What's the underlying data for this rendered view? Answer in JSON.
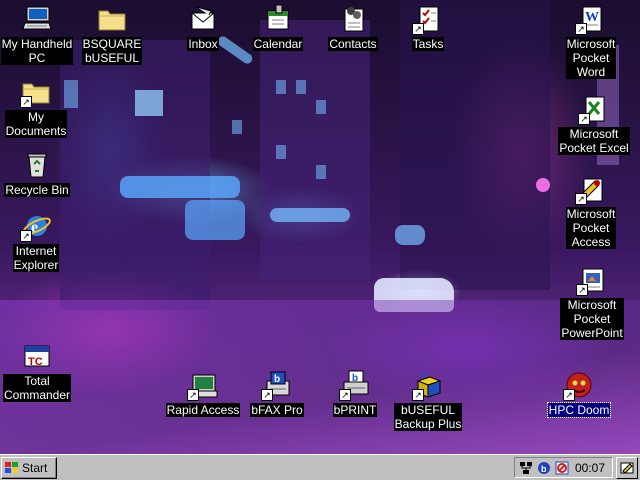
{
  "desktop": {
    "icons": [
      {
        "label": "My Handheld\nPC",
        "icon": "handheld-pc-icon",
        "shortcut": false
      },
      {
        "label": "BSQUARE\nbUSEFUL",
        "icon": "folder-icon",
        "shortcut": false
      },
      {
        "label": "Inbox",
        "icon": "inbox-icon",
        "shortcut": false
      },
      {
        "label": "Calendar",
        "icon": "calendar-icon",
        "shortcut": false
      },
      {
        "label": "Contacts",
        "icon": "contacts-icon",
        "shortcut": false
      },
      {
        "label": "Tasks",
        "icon": "tasks-icon",
        "shortcut": true
      },
      {
        "label": "Microsoft\nPocket\nWord",
        "icon": "pocket-word-icon",
        "shortcut": true
      },
      {
        "label": "My\nDocuments",
        "icon": "folder-icon",
        "shortcut": true
      },
      {
        "label": "Microsoft\nPocket Excel",
        "icon": "pocket-excel-icon",
        "shortcut": true
      },
      {
        "label": "Recycle Bin",
        "icon": "recycle-bin-icon",
        "shortcut": false
      },
      {
        "label": "Internet\nExplorer",
        "icon": "internet-explorer-icon",
        "shortcut": true
      },
      {
        "label": "Microsoft\nPocket\nAccess",
        "icon": "pocket-access-icon",
        "shortcut": true
      },
      {
        "label": "Microsoft\nPocket\nPowerPoint",
        "icon": "pocket-powerpoint-icon",
        "shortcut": true
      },
      {
        "label": "Total\nCommander",
        "icon": "total-commander-icon",
        "shortcut": false
      },
      {
        "label": "Rapid Access",
        "icon": "rapid-access-icon",
        "shortcut": true
      },
      {
        "label": "bFAX Pro",
        "icon": "bfax-pro-icon",
        "shortcut": true
      },
      {
        "label": "bPRINT",
        "icon": "bprint-icon",
        "shortcut": true
      },
      {
        "label": "bUSEFUL\nBackup Plus",
        "icon": "buseful-backup-icon",
        "shortcut": true
      },
      {
        "label": "HPC Doom",
        "icon": "hpc-doom-icon",
        "shortcut": true,
        "selected": true
      }
    ]
  },
  "taskbar": {
    "start_label": "Start",
    "clock": "00:07",
    "tray_icons": [
      "network-icon",
      "bsquare-tray-icon",
      "stop-icon"
    ],
    "desktop_button_icon": "show-desktop-icon"
  },
  "colors": {
    "taskbar": "#c0c0c0",
    "label_bg": "#000000",
    "selected_label_bg": "#000080"
  }
}
